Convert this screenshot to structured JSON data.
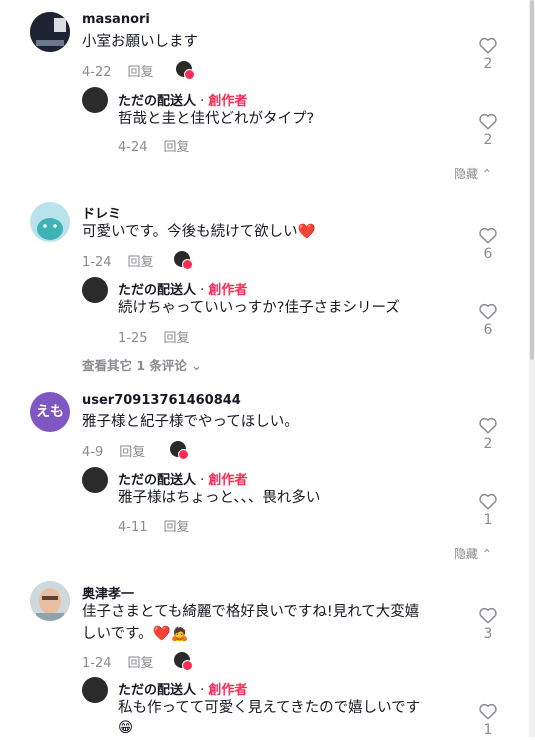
{
  "comments": [
    {
      "user": "masanori",
      "text": "小室お願いします",
      "date": "4-22",
      "reply_label": "回复",
      "likes": "2",
      "reply": {
        "user": "ただの配送人",
        "creator_label": "創作者",
        "text": "哲哉と圭と佳代どれがタイプ?",
        "date": "4-24",
        "reply_label": "回复",
        "likes": "2"
      },
      "footer": "隐藏"
    },
    {
      "user": "ドレミ",
      "text": "可愛いです。今後も続けて欲しい❤️",
      "date": "1-24",
      "reply_label": "回复",
      "likes": "6",
      "reply": {
        "user": "ただの配送人",
        "creator_label": "創作者",
        "text": "続けちゃっていいっすか?佳子さまシリーズ",
        "date": "1-25",
        "reply_label": "回复",
        "likes": "6"
      },
      "footer": "查看其它 1 条评论"
    },
    {
      "user": "user70913761460844",
      "avatar_text": "えも",
      "text": "雅子様と紀子様でやってほしい。",
      "date": "4-9",
      "reply_label": "回复",
      "likes": "2",
      "reply": {
        "user": "ただの配送人",
        "creator_label": "創作者",
        "text": "雅子様はちょっと、、、畏れ多い",
        "date": "4-11",
        "reply_label": "回复",
        "likes": "1"
      },
      "footer": "隐藏"
    },
    {
      "user": "奥津孝一",
      "text_line1": "佳子さまとても綺麗で格好良いですね!見れて大変嬉",
      "text_line2": "しいです。❤️🙇",
      "date": "1-24",
      "reply_label": "回复",
      "likes": "3",
      "reply": {
        "user": "ただの配送人",
        "creator_label": "創作者",
        "text_line1": "私も作ってて可愛く見えてきたので嬉しいです",
        "text_line2": "😁",
        "likes": "1"
      }
    }
  ],
  "colors": {
    "creator": "#fe2c55",
    "meta": "#8a8b91",
    "avatar_emo": "#7e57c2",
    "avatar_doremi": "#b8e3ea"
  }
}
